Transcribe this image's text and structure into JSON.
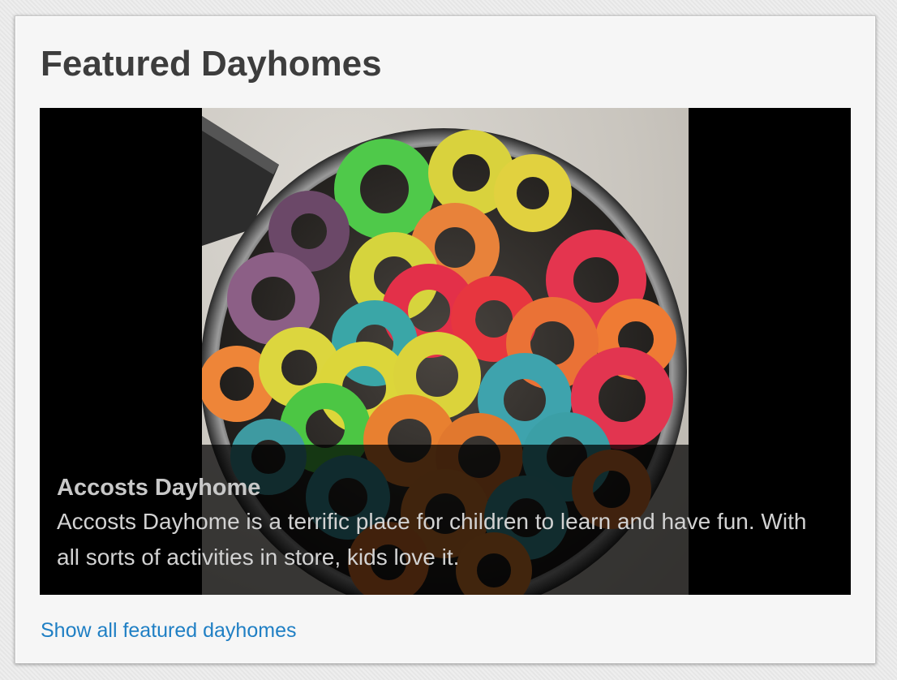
{
  "widget": {
    "title": "Featured Dayhomes"
  },
  "slide": {
    "image_subject": "bowl of colorful ring-shaped cereal",
    "caption_title": "Accosts Dayhome",
    "caption_text": "Accosts Dayhome is a terrific place for children to learn and have fun. With all sorts of activities in store, kids love it."
  },
  "footer": {
    "link_label": "Show all featured dayhomes"
  },
  "colors": {
    "title_text": "#3d3d3d",
    "link": "#1f7fc4",
    "slider_background": "#000000",
    "caption_overlay": "rgba(0,0,0,0.72)"
  }
}
